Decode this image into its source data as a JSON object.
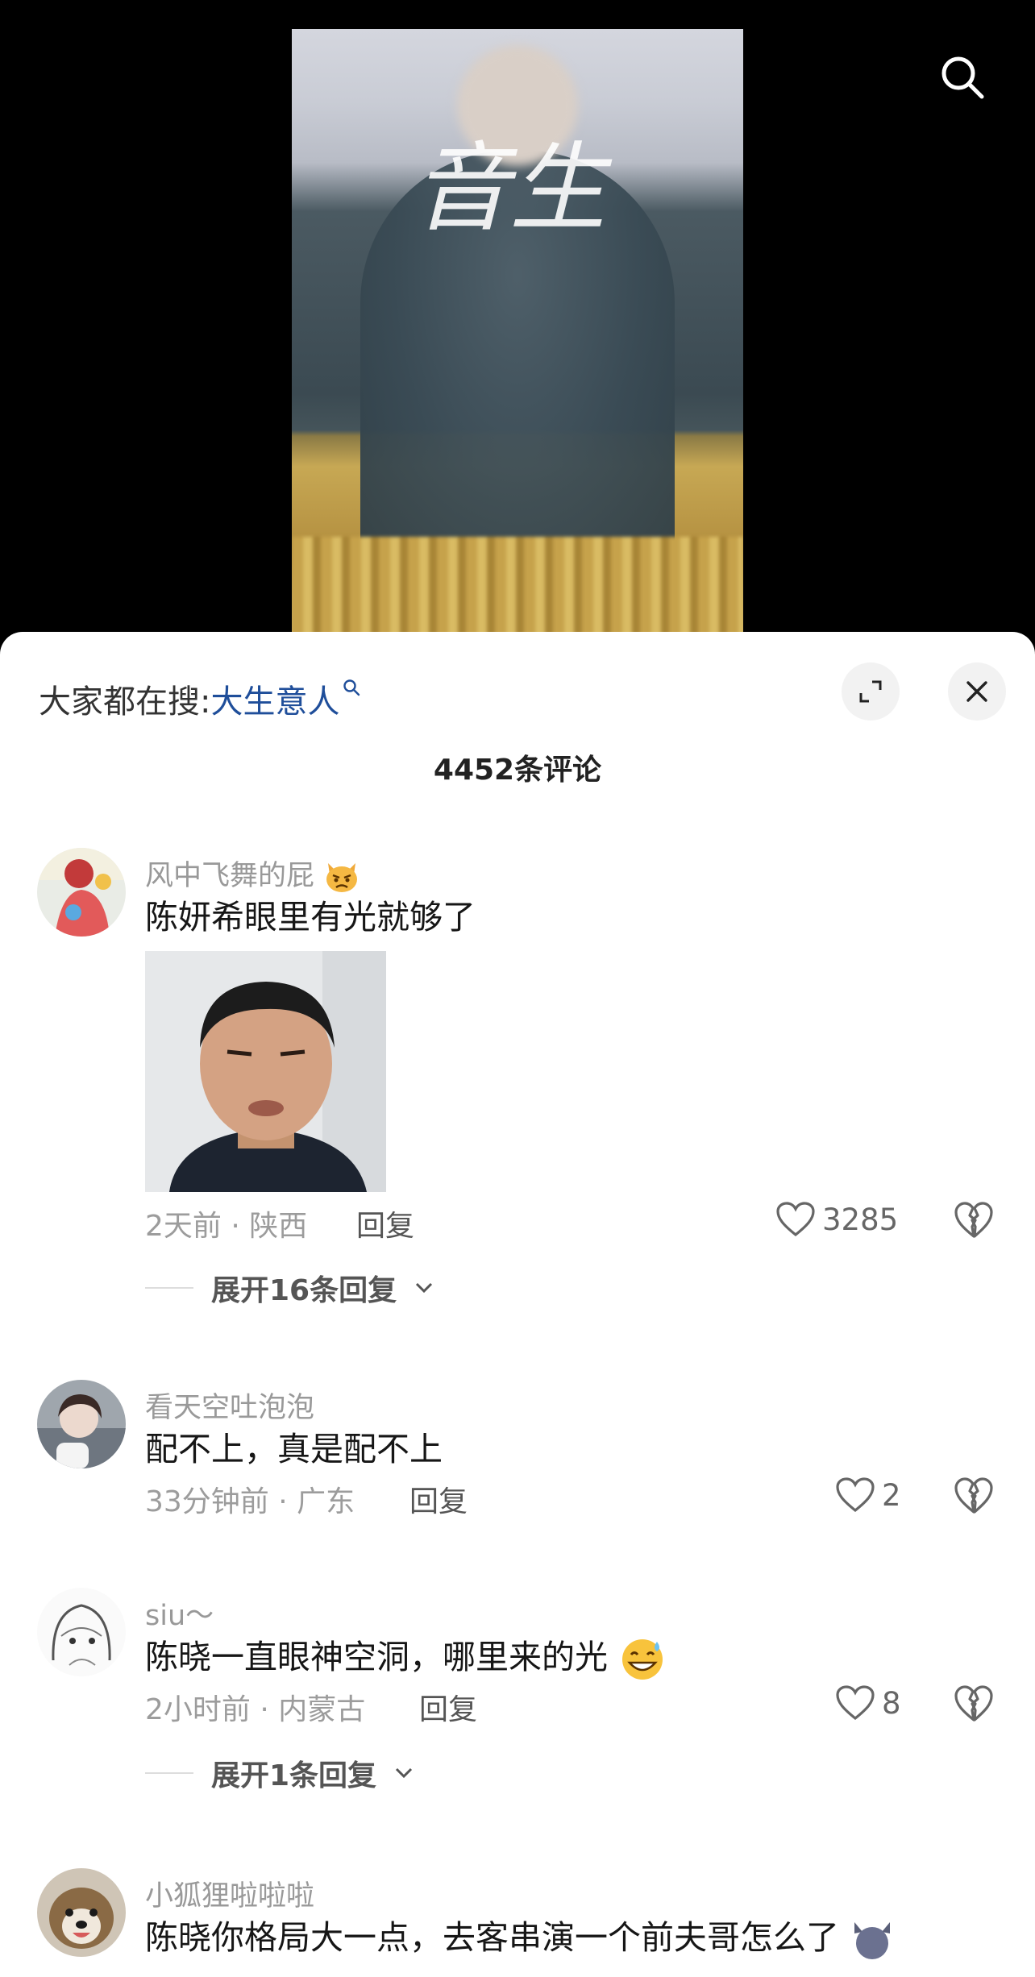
{
  "hot_search": {
    "prefix": "大家都在搜:",
    "term": "大生意人"
  },
  "comment_count": "4452条评论",
  "comments": [
    {
      "user": "风中飞舞的屁",
      "text": "陈妍希眼里有光就够了",
      "time": "2天前 · 陕西",
      "reply_label": "回复",
      "likes": "3285",
      "expand_replies": "展开16条回复"
    },
    {
      "user": "看天空吐泡泡",
      "text": "配不上，真是配不上",
      "time": "33分钟前 · 广东",
      "reply_label": "回复",
      "likes": "2"
    },
    {
      "user": "siu～",
      "text": "陈晓一直眼神空洞，哪里来的光",
      "time": "2小时前 · 内蒙古",
      "reply_label": "回复",
      "likes": "8",
      "expand_replies": "展开1条回复"
    },
    {
      "user": "小狐狸啦啦啦",
      "text": "陈晓你格局大一点，去客串演一个前夫哥怎么了"
    }
  ],
  "video": {
    "watermark": "音生"
  },
  "colors": {
    "link": "#1f4e9a",
    "sheet_bg": "#ffffff",
    "page_bg": "#000000"
  },
  "icons": [
    "search-icon",
    "expand-icon",
    "close-icon",
    "heart-icon",
    "broken-heart-icon",
    "chevron-down-icon"
  ]
}
